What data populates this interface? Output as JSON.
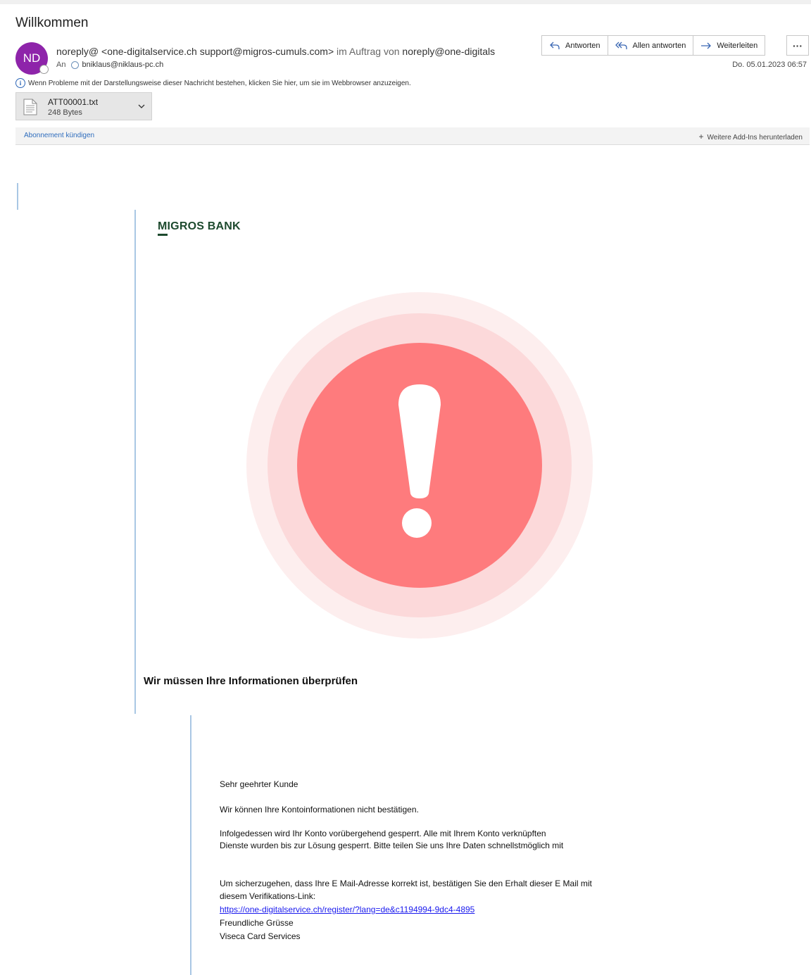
{
  "header": {
    "subject": "Willkommen",
    "avatar_initials": "ND",
    "from_main": "noreply@ <one-digitalservice.ch support@migros-cumuls.com>",
    "from_obo": " im Auftrag von ",
    "from_tail": "noreply@one-digitals",
    "to_label": "An",
    "to_address": "bniklaus@niklaus-pc.ch",
    "date": "Do. 05.01.2023 06:57",
    "info_text": "Wenn Probleme mit der Darstellungsweise dieser Nachricht bestehen, klicken Sie hier, um sie im Webbrowser anzuzeigen.",
    "accent": "#8e24aa"
  },
  "actions": {
    "reply": "Antworten",
    "reply_all": "Allen antworten",
    "forward": "Weiterleiten",
    "more": "···"
  },
  "attachment": {
    "name": "ATT00001.txt",
    "size": "248 Bytes"
  },
  "addin_bar": {
    "unsubscribe": "Abonnement kündigen",
    "more_addins": "Weitere Add-Ins herunterladen"
  },
  "body": {
    "logo_first": "M",
    "logo_rest": "IGROS BANK",
    "headline": "Wir müssen Ihre Informationen überprüfen",
    "greeting": "Sehr geehrter Kunde",
    "line1": "Wir können Ihre Kontoinformationen nicht bestätigen.",
    "line2a": "Infolgedessen wird Ihr Konto vorübergehend gesperrt. Alle mit Ihrem Konto verknüpften",
    "line2b": "Dienste wurden bis zur Lösung gesperrt. Bitte teilen Sie uns Ihre Daten schnellstmöglich mit",
    "line3a": "Um sicherzugehen, dass Ihre E Mail-Adresse korrekt ist, bestätigen Sie den Erhalt dieser E Mail mit",
    "line3b": "diesem Verifikations-Link:",
    "link": "https://one-digitalservice.ch/register/?lang=de&c1194994-9dc4-4895",
    "closing": "Freundliche Grüsse",
    "signature": "Viseca Card Services",
    "alert_colors": [
      "#fdeeee",
      "#fcd9da",
      "#fe7b7d"
    ]
  }
}
